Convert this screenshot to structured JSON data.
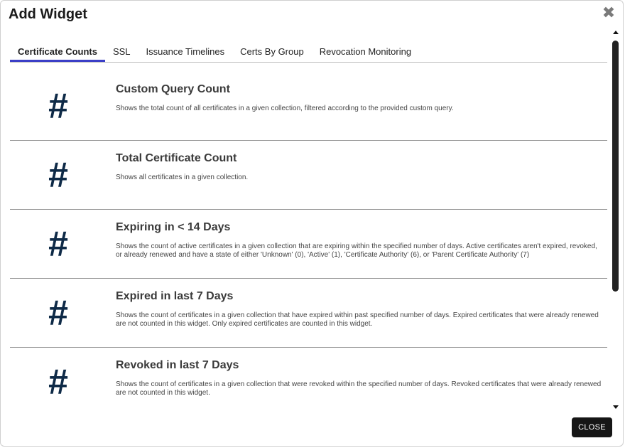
{
  "dialog": {
    "title": "Add Widget",
    "close_icon": "close-icon",
    "close_button_label": "CLOSE"
  },
  "tabs": [
    {
      "label": "Certificate Counts",
      "active": true
    },
    {
      "label": "SSL",
      "active": false
    },
    {
      "label": "Issuance Timelines",
      "active": false
    },
    {
      "label": "Certs By Group",
      "active": false
    },
    {
      "label": "Revocation Monitoring",
      "active": false
    }
  ],
  "widgets": [
    {
      "icon": "hash-icon",
      "glyph": "#",
      "title": "Custom Query Count",
      "description": "Shows the total count of all certificates in a given collection, filtered according to the provided custom query."
    },
    {
      "icon": "hash-icon",
      "glyph": "#",
      "title": "Total Certificate Count",
      "description": "Shows all certificates in a given collection."
    },
    {
      "icon": "hash-icon",
      "glyph": "#",
      "title": "Expiring in < 14 Days",
      "description": "Shows the count of active certificates in a given collection that are expiring within the specified number of days. Active certificates aren't expired, revoked, or already renewed and have a state of either 'Unknown' (0), 'Active' (1), 'Certificate Authority' (6), or 'Parent Certificate Authority' (7)"
    },
    {
      "icon": "hash-icon",
      "glyph": "#",
      "title": "Expired in last 7 Days",
      "description": "Shows the count of certificates in a given collection that have expired within past specified number of days. Expired certificates that were already renewed are not counted in this widget. Only expired certificates are counted in this widget."
    },
    {
      "icon": "hash-icon",
      "glyph": "#",
      "title": "Revoked in last 7 Days",
      "description": "Shows the count of certificates in a given collection that were revoked within the specified number of days. Revoked certificates that were already renewed are not counted in this widget."
    }
  ],
  "colors": {
    "accent": "#3b3fc7",
    "icon": "#0e2a47",
    "button": "#161616"
  }
}
